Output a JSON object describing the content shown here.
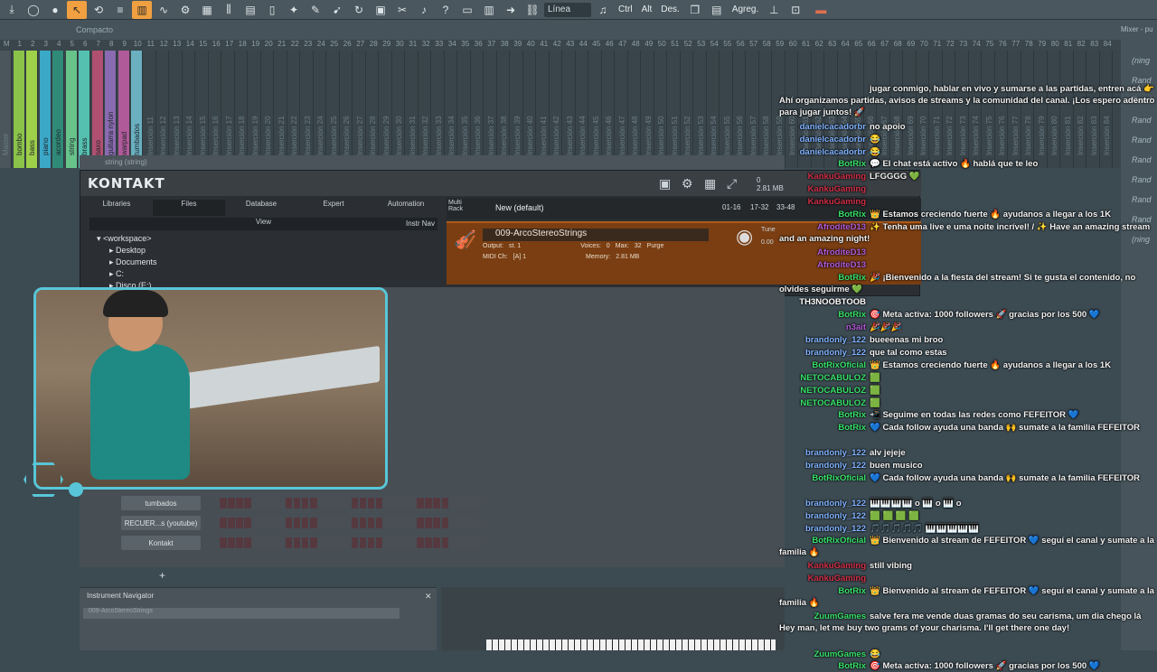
{
  "toolbar": {
    "mode": "Línea",
    "ctrl": "Ctrl",
    "alt": "Alt",
    "des": "Des.",
    "agreg": "Agreg.",
    "view_label": "Compacto",
    "mixer_label": "Mixer - pu"
  },
  "mixer": {
    "tracks": [
      "Master",
      "bombo",
      "bass",
      "piano",
      "acordeo",
      "string",
      "brass",
      "saxo",
      "guitarra nylon",
      "warpad",
      "tumbados"
    ],
    "insert_prefix": "Inserción",
    "colors": [
      "#4a565c",
      "#8bc24a",
      "#9ed04a",
      "#3ca8c8",
      "#2f8a78",
      "#67c38a",
      "#55c0b0",
      "#b05070",
      "#8a6ab0",
      "#b05a9a",
      "#6ab0c0"
    ]
  },
  "kontakt": {
    "window_title": "string (string)",
    "logo": "KONTAKT",
    "cpu": "0",
    "mem": "2.81 MB",
    "tabs": [
      "Libraries",
      "Files",
      "Database",
      "Expert",
      "Automation"
    ],
    "selected_tab": "Files",
    "view": "View",
    "instr_nav": "Instr Nav",
    "tree": [
      "<workspace>",
      "Desktop",
      "Documents",
      "C:",
      "Disco (E:)"
    ],
    "multi_rack": "Multi Rack",
    "preset": "New (default)",
    "range1": "01-16",
    "range2": "17-32",
    "range3": "33-48",
    "instrument_name": "009-ArcoStereoStrings",
    "output_label": "Output:",
    "output_val": "st. 1",
    "voices_label": "Voices:",
    "voices_val": "0",
    "max_label": "Max:",
    "max_val": "32",
    "purge": "Purge",
    "midi_label": "MIDI Ch:",
    "midi_val": "[A] 1",
    "memory_label": "Memory:",
    "memory_val": "2.81 MB",
    "tune_label": "Tune",
    "tune_val": "0.00"
  },
  "rack": {
    "rows": [
      {
        "name": "tumbados"
      },
      {
        "name": "RECUER...s (youtube)"
      },
      {
        "name": "Kontakt"
      }
    ],
    "add": "+"
  },
  "navigator": {
    "title": "Instrument Navigator",
    "field": "009-ArcoStereoStrings"
  },
  "right_panel": [
    "(ning",
    "Rand",
    "Rand",
    "Rand",
    "Rand",
    "Rand",
    "Rand",
    "Rand",
    "Rand",
    "(ning"
  ],
  "chat": [
    {
      "user": "",
      "text": "jugar conmigo, hablar en vivo y sumarse a las partidas, entren acá 👉 Ahí organizamos partidas, avisos de streams y la comunidad del canal. ¡Los espero adentro para jugar juntos! 🚀",
      "color": "white"
    },
    {
      "user": "danielcacadorbr",
      "text": "no apoio",
      "color": "blue"
    },
    {
      "user": "danielcacadorbr",
      "text": "😂",
      "color": "blue"
    },
    {
      "user": "danielcacadorbr",
      "text": "😂",
      "color": "blue"
    },
    {
      "user": "BotRix",
      "text": "💬 El chat está activo 🔥 hablá que te leo",
      "color": "green"
    },
    {
      "user": "KankuGaming",
      "text": "LFGGGG 💚",
      "color": "red"
    },
    {
      "user": "KankuGaming",
      "text": "",
      "color": "red"
    },
    {
      "user": "KankuGaming",
      "text": "",
      "color": "red"
    },
    {
      "user": "BotRix",
      "text": "👑 Estamos creciendo fuerte 🔥 ayudanos a llegar a los 1K",
      "color": "green"
    },
    {
      "user": "AfroditeD13",
      "text": "✨ Tenha uma live e uma noite incrível! / ✨ Have an amazing stream and an amazing night!",
      "color": "pink"
    },
    {
      "user": "AfroditeD13",
      "text": "",
      "color": "pink"
    },
    {
      "user": "AfroditeD13",
      "text": "",
      "color": "pink"
    },
    {
      "user": "BotRix",
      "text": "🎉 ¡Bienvenido a la fiesta del stream! Si te gusta el contenido, no olvides seguirme 💚",
      "color": "green"
    },
    {
      "user": "TH3NOOBTOOB",
      "text": "",
      "color": "white"
    },
    {
      "user": "BotRix",
      "text": "🎯 Meta activa: 1000 followers 🚀 gracias por los 500 💙",
      "color": "green"
    },
    {
      "user": "n3ait",
      "text": "🎉🎉🎉",
      "color": "pink"
    },
    {
      "user": "brandonly_122",
      "text": "bueeenas mi broo",
      "color": "blue"
    },
    {
      "user": "brandonly_122",
      "text": "que tal como estas",
      "color": "blue"
    },
    {
      "user": "BotRixOficial",
      "text": "👑 Estamos creciendo fuerte 🔥 ayudanos a llegar a los 1K",
      "color": "green"
    },
    {
      "user": "NETOCABULOZ",
      "text": "🟩",
      "color": "green"
    },
    {
      "user": "NETOCABULOZ",
      "text": "🟩",
      "color": "green"
    },
    {
      "user": "NETOCABULOZ",
      "text": "🟩",
      "color": "green"
    },
    {
      "user": "BotRix",
      "text": "📲 Seguime en todas las redes como FEFEITOR 💙",
      "color": "green"
    },
    {
      "user": "BotRix",
      "text": "💙 Cada follow ayuda una banda 🙌 sumate a la familia FEFEITOR",
      "color": "green"
    },
    {
      "user": "brandonly_122",
      "text": "alv jejeje",
      "color": "blue"
    },
    {
      "user": "brandonly_122",
      "text": "buen musico",
      "color": "blue"
    },
    {
      "user": "BotRixOficial",
      "text": "💙 Cada follow ayuda una banda 🙌 sumate a la familia FEFEITOR",
      "color": "green"
    },
    {
      "user": "brandonly_122",
      "text": "🎹🎹🎹🎹 o 🎹 o 🎹 o",
      "color": "blue"
    },
    {
      "user": "brandonly_122",
      "text": "🟩 🟩 🟩 🟩",
      "color": "blue"
    },
    {
      "user": "brandonly_122",
      "text": "🎵🎵🎵🎵🎵 🎹🎹🎹🎹🎹",
      "color": "blue"
    },
    {
      "user": "BotRixOficial",
      "text": "👑 Bienvenido al stream de FEFEITOR 💙 seguí el canal y sumate a la familia 🔥",
      "color": "green"
    },
    {
      "user": "KankuGaming",
      "text": "still vibing",
      "color": "red"
    },
    {
      "user": "KankuGaming",
      "text": "",
      "color": "red"
    },
    {
      "user": "BotRix",
      "text": "👑 Bienvenido al stream de FEFEITOR 💙 seguí el canal y sumate a la familia 🔥",
      "color": "green"
    },
    {
      "user": "ZuumGames",
      "text": "salve fera me vende duas gramas do seu carisma, um dia chego lá Hey man, let me buy two grams of your charisma. I'll get there one day!",
      "color": "green"
    },
    {
      "user": "ZuumGames",
      "text": "😂",
      "color": "green"
    },
    {
      "user": "BotRix",
      "text": "🎯 Meta activa: 1000 followers 🚀 gracias por los 500 💙",
      "color": "green"
    }
  ]
}
